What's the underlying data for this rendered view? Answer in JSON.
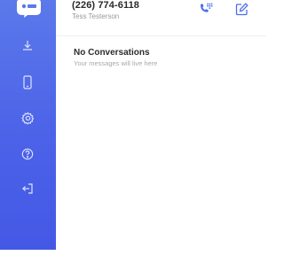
{
  "header": {
    "phone_number": "(226) 774-6118",
    "user_name": "Tess Testerson",
    "dialpad_icon": "phone-dialpad-icon",
    "compose_icon": "compose-icon"
  },
  "sidebar": {
    "logo": "textnow-logo",
    "items": [
      {
        "icon": "download-icon"
      },
      {
        "icon": "device-icon"
      },
      {
        "icon": "gear-icon"
      },
      {
        "icon": "help-icon"
      },
      {
        "icon": "logout-icon"
      }
    ]
  },
  "main": {
    "empty_title": "No Conversations",
    "empty_subtitle": "Your messages will live here"
  },
  "colors": {
    "sidebar_top": "#5b79ea",
    "sidebar_bottom": "#4458e6",
    "accent": "#4c6ee8"
  }
}
